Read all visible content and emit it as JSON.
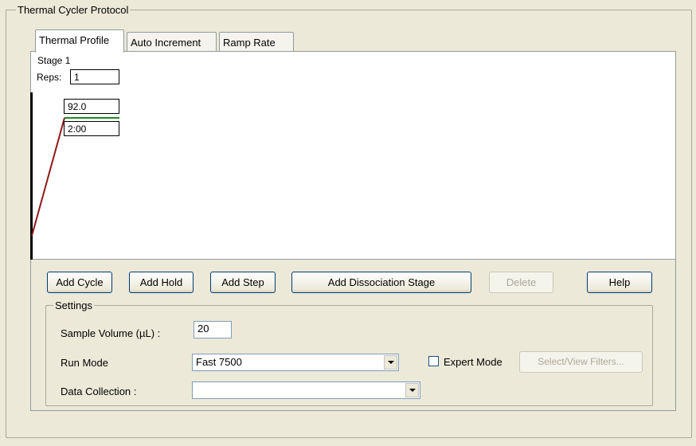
{
  "window": {
    "group_title": "Thermal Cycler Protocol"
  },
  "tabs": [
    {
      "label": "Thermal Profile",
      "active": true
    },
    {
      "label": "Auto Increment",
      "active": false
    },
    {
      "label": "Ramp Rate",
      "active": false
    }
  ],
  "profile": {
    "stage_label": "Stage 1",
    "reps_label": "Reps:",
    "reps_value": "1",
    "temperature": "92.0",
    "time": "2:00"
  },
  "buttons": {
    "add_cycle": "Add Cycle",
    "add_hold": "Add Hold",
    "add_step": "Add Step",
    "add_dissociation": "Add Dissociation Stage",
    "delete": "Delete",
    "help": "Help"
  },
  "settings": {
    "group_title": "Settings",
    "sample_volume_label": "Sample Volume (µL) :",
    "sample_volume_value": "20",
    "run_mode_label": "Run Mode",
    "run_mode_value": "Fast 7500",
    "expert_mode_label": "Expert Mode",
    "expert_mode_checked": false,
    "select_filters_label": "Select/View Filters...",
    "data_collection_label": "Data Collection :",
    "data_collection_value": ""
  },
  "colors": {
    "ramp_line": "#8b1a1a",
    "hold_line": "#1f8a1f",
    "stage_bar": "#000000"
  }
}
